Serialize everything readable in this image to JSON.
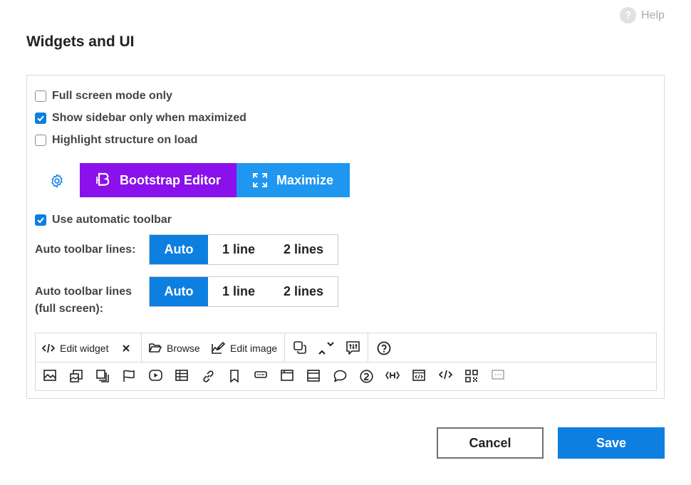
{
  "help": {
    "label": "Help",
    "icon": "question-circle-icon"
  },
  "title": "Widgets and UI",
  "options": {
    "fullscreen_only": {
      "label": "Full screen mode only",
      "checked": false
    },
    "sidebar_maximized": {
      "label": "Show sidebar only when maximized",
      "checked": true
    },
    "highlight_structure": {
      "label": "Highlight structure on load",
      "checked": false
    }
  },
  "buttons": {
    "bootstrap_editor": "Bootstrap Editor",
    "maximize": "Maximize"
  },
  "auto_toolbar": {
    "label": "Use automatic toolbar",
    "checked": true
  },
  "toolbar_lines": {
    "label": "Auto toolbar lines:",
    "options": [
      "Auto",
      "1 line",
      "2 lines"
    ],
    "selected": "Auto"
  },
  "toolbar_lines_fullscreen": {
    "label_line1": "Auto toolbar lines",
    "label_line2": "(full screen):",
    "options": [
      "Auto",
      "1 line",
      "2 lines"
    ],
    "selected": "Auto"
  },
  "toolbar": {
    "edit_widget": "Edit widget",
    "browse": "Browse",
    "edit_image": "Edit image"
  },
  "footer": {
    "cancel": "Cancel",
    "save": "Save"
  },
  "colors": {
    "primary": "#0d7fe0",
    "bootstrap": "#8a10ec",
    "maximize": "#1f96f0"
  }
}
